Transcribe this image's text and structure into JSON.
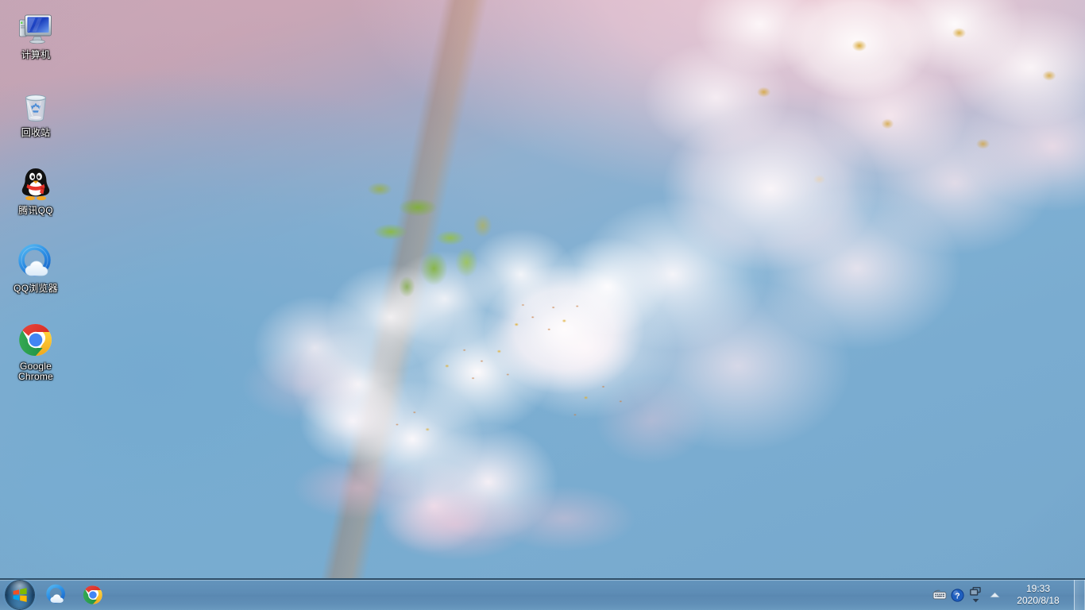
{
  "desktop": {
    "wallpaper_name": "cherry-blossom-photo",
    "wallpaper_colors": {
      "sky_blue": "#7fb0d3",
      "pink_top": "#c9a8b8",
      "blossom_white": "#fffaf9",
      "blossom_pink": "#f3c4d6",
      "stamen_gold": "#d6a42c",
      "leaf_green": "#8ab93c"
    },
    "icons": [
      {
        "label": "计算机",
        "icon": "computer-icon",
        "name": "desktop-icon-computer"
      },
      {
        "label": "回收站",
        "icon": "recycle-bin-icon",
        "name": "desktop-icon-recycle-bin"
      },
      {
        "label": "腾讯QQ",
        "icon": "qq-penguin-icon",
        "name": "desktop-icon-tencent-qq"
      },
      {
        "label": "QQ浏览器",
        "icon": "qq-browser-icon",
        "name": "desktop-icon-qq-browser"
      },
      {
        "label": "Google Chrome",
        "icon": "chrome-icon",
        "name": "desktop-icon-google-chrome"
      }
    ]
  },
  "taskbar": {
    "background_color": "#5d8cb5",
    "start_button": {
      "label": "开始",
      "icon": "windows-start-orb"
    },
    "pinned": [
      {
        "label": "QQ浏览器",
        "icon": "qq-browser-icon",
        "name": "taskbar-button-qq-browser"
      },
      {
        "label": "Google Chrome",
        "icon": "chrome-icon",
        "name": "taskbar-button-chrome"
      }
    ],
    "tray": {
      "icons": [
        {
          "label": "输入法",
          "icon": "keyboard-ime-icon",
          "name": "tray-icon-ime"
        },
        {
          "label": "帮助",
          "icon": "help-question-icon",
          "name": "tray-icon-help"
        }
      ],
      "stack_icon": {
        "label": "切换窗口",
        "icon": "cascade-windows-icon"
      },
      "stack_caret": {
        "label": "更多",
        "icon": "caret-down-icon"
      },
      "expand": {
        "label": "显示隐藏的图标",
        "icon": "caret-up-icon"
      }
    },
    "clock": {
      "time": "19:33",
      "date": "2020/8/18"
    },
    "show_desktop": {
      "label": "显示桌面"
    }
  }
}
